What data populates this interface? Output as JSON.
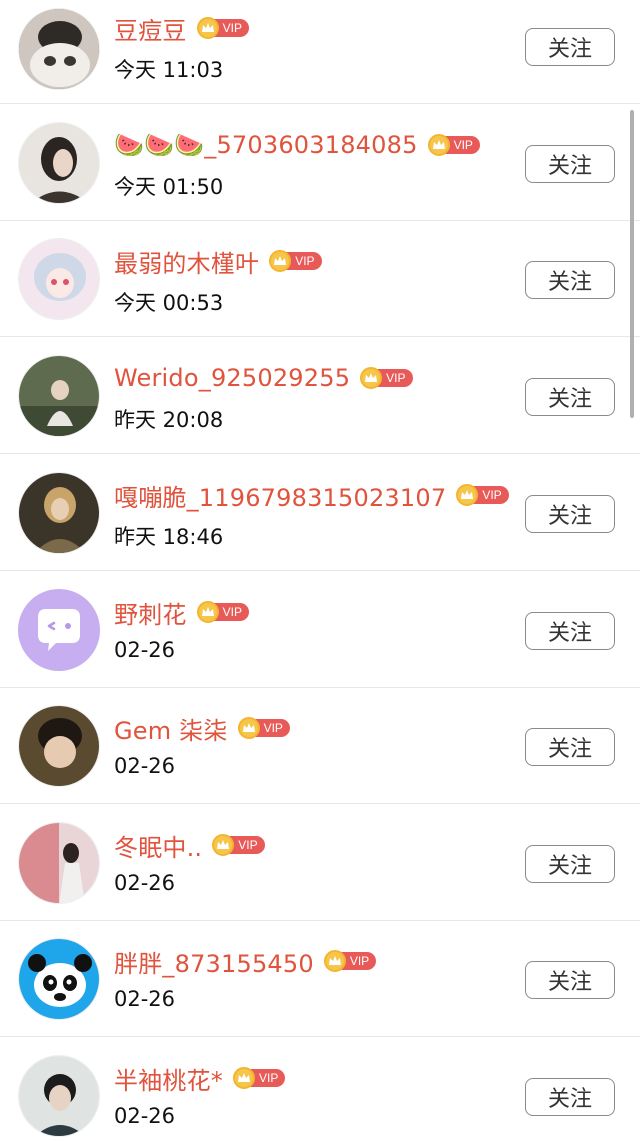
{
  "follow_label": "关注",
  "vip_label": "VIP",
  "colors": {
    "name": "#e0533d",
    "vip_badge": "#e85a58",
    "crown": "#f6c64a"
  },
  "users": [
    {
      "name": "豆痘豆",
      "time": "今天 11:03"
    },
    {
      "name": "🍉🍉🍉_5703603184085",
      "time": "今天 01:50"
    },
    {
      "name": "最弱的木槿叶",
      "time": "今天 00:53"
    },
    {
      "name": "Werido_925029255",
      "time": "昨天 20:08"
    },
    {
      "name": "嘎嘣脆_1196798315023107",
      "time": "昨天 18:46"
    },
    {
      "name": "野刺花",
      "time": "02-26"
    },
    {
      "name": "Gem 柒柒",
      "time": "02-26"
    },
    {
      "name": "冬眠中..",
      "time": "02-26"
    },
    {
      "name": "胖胖_873155450",
      "time": "02-26"
    },
    {
      "name": "半袖桃花*",
      "time": "02-26"
    }
  ]
}
